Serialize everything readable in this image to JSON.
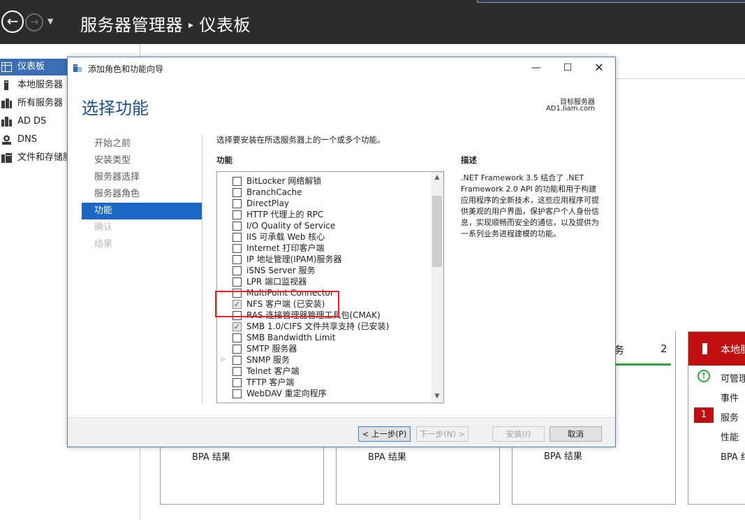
{
  "sm": {
    "title": "服务器管理器",
    "breadcrumb_sep": "▸",
    "breadcrumb_page": "仪表板",
    "back_glyph": "←",
    "forward_glyph": "→",
    "dropdown_glyph": "▼",
    "sidebar": [
      {
        "label": "仪表板",
        "icon": "dashboard-icon",
        "active": true
      },
      {
        "label": "本地服务器",
        "icon": "local-server-icon"
      },
      {
        "label": "所有服务器",
        "icon": "all-servers-icon"
      },
      {
        "label": "AD DS",
        "icon": "ad-ds-icon"
      },
      {
        "label": "DNS",
        "icon": "dns-icon"
      },
      {
        "label": "文件和存储服务",
        "icon": "file-storage-icon"
      }
    ],
    "tiles": [
      {
        "bpa": "BPA 结果"
      },
      {
        "bpa": "BPA 结果"
      },
      {
        "bpa": "BPA 结果",
        "label": "务",
        "count": "2"
      },
      {
        "label": "本地服务器",
        "rows": [
          "可管理性",
          "事件",
          "服务",
          "性能",
          "BPA 结果"
        ],
        "badge": "1"
      }
    ],
    "colors": {
      "header": "#2c2c2c",
      "active": "#3c6eb4",
      "alert": "#c00f0f",
      "ok": "#27a832"
    }
  },
  "wizard": {
    "window_title": "添加角色和功能向导",
    "controls": {
      "minimize": "—",
      "maximize": "☐",
      "close": "✕"
    },
    "heading": "选择功能",
    "target_label": "目标服务器",
    "target_value": "AD1.liam.com",
    "steps": [
      {
        "label": "开始之前",
        "state": "normal"
      },
      {
        "label": "安装类型",
        "state": "normal"
      },
      {
        "label": "服务器选择",
        "state": "normal"
      },
      {
        "label": "服务器角色",
        "state": "normal"
      },
      {
        "label": "功能",
        "state": "active"
      },
      {
        "label": "确认",
        "state": "disabled"
      },
      {
        "label": "结果",
        "state": "disabled"
      }
    ],
    "instruction": "选择要安装在所选服务器上的一个或多个功能。",
    "features_label": "功能",
    "description_label": "描述",
    "description": ".NET Framework 3.5 结合了 .NET Framework 2.0 API 的功能和用于构建应用程序的全新技术，这些应用程序可提供美观的用户界面，保护客户个人身份信息，实现顺畅而安全的通信，以及提供为一系列业务进程建模的功能。",
    "features": [
      {
        "label": "BitLocker 网络解锁",
        "checked": false,
        "expandable": false
      },
      {
        "label": "BranchCache",
        "checked": false,
        "expandable": false
      },
      {
        "label": "DirectPlay",
        "checked": false,
        "expandable": false
      },
      {
        "label": "HTTP 代理上的 RPC",
        "checked": false,
        "expandable": false
      },
      {
        "label": "I/O Quality of Service",
        "checked": false,
        "expandable": false
      },
      {
        "label": "IIS 可承载 Web 核心",
        "checked": false,
        "expandable": false
      },
      {
        "label": "Internet 打印客户端",
        "checked": false,
        "expandable": false
      },
      {
        "label": "IP 地址管理(IPAM)服务器",
        "checked": false,
        "expandable": false
      },
      {
        "label": "iSNS Server 服务",
        "checked": false,
        "expandable": false
      },
      {
        "label": "LPR 端口监视器",
        "checked": false,
        "expandable": false
      },
      {
        "label": "MultiPoint Connector",
        "checked": false,
        "expandable": true
      },
      {
        "label": "NFS 客户端 (已安装)",
        "checked": true,
        "expandable": false
      },
      {
        "label": "RAS 连接管理器管理工具包(CMAK)",
        "checked": false,
        "expandable": false
      },
      {
        "label": "SMB 1.0/CIFS 文件共享支持 (已安装)",
        "checked": true,
        "expandable": false
      },
      {
        "label": "SMB Bandwidth Limit",
        "checked": false,
        "expandable": false
      },
      {
        "label": "SMTP 服务器",
        "checked": false,
        "expandable": false
      },
      {
        "label": "SNMP 服务",
        "checked": false,
        "expandable": true
      },
      {
        "label": "Telnet 客户端",
        "checked": false,
        "expandable": false
      },
      {
        "label": "TFTP 客户端",
        "checked": false,
        "expandable": false
      },
      {
        "label": "WebDAV 重定向程序",
        "checked": false,
        "expandable": false
      }
    ],
    "buttons": {
      "prev": "< 上一步(P)",
      "next": "下一步(N) >",
      "install": "安装(I)",
      "cancel": "取消"
    }
  }
}
